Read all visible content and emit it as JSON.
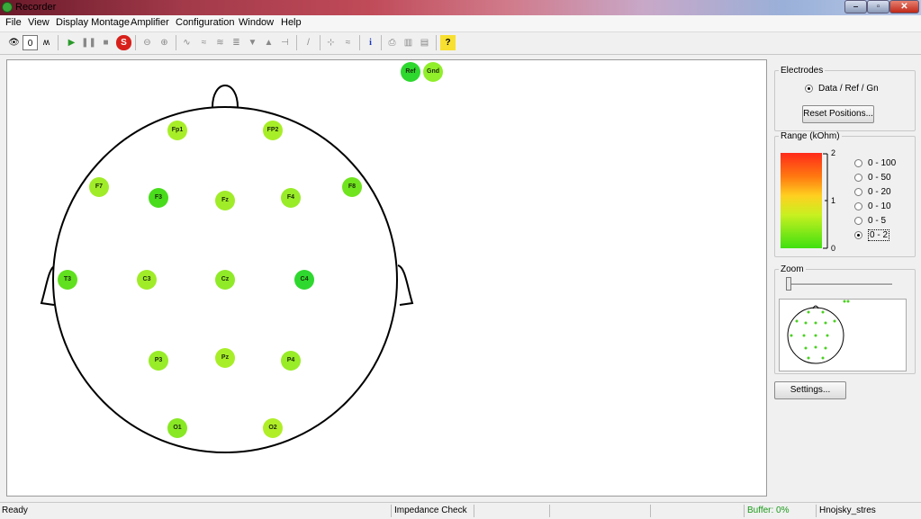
{
  "window": {
    "title": "Recorder",
    "controls": {
      "minimize": "–",
      "maximize": "▫",
      "close": "✕"
    }
  },
  "menu": [
    "File",
    "View",
    "Display Montage",
    "Amplifier",
    "Configuration",
    "Window",
    "Help"
  ],
  "toolbar": {
    "buttons": [
      {
        "name": "monitor-eye-icon",
        "glyph": "👁"
      },
      {
        "name": "impedance-zero-icon",
        "glyph": "0"
      },
      {
        "name": "wave-icon",
        "glyph": "ʍ"
      },
      {
        "name": "play-icon",
        "glyph": "▶"
      },
      {
        "name": "pause-icon",
        "glyph": "❚❚"
      },
      {
        "name": "stop-icon",
        "glyph": "■"
      },
      {
        "name": "record-icon",
        "glyph": "S"
      },
      {
        "name": "zoom-out-icon",
        "glyph": "⊖"
      },
      {
        "name": "zoom-in-icon",
        "glyph": "⊕"
      },
      {
        "name": "signal-icon",
        "glyph": "∿"
      },
      {
        "name": "signal-icon-2",
        "glyph": "≈"
      },
      {
        "name": "filter-icon",
        "glyph": "≋"
      },
      {
        "name": "overlay-icon",
        "glyph": "≣"
      },
      {
        "name": "overlay-icon-2",
        "glyph": "≋"
      },
      {
        "name": "triangle-down-icon",
        "glyph": "▼"
      },
      {
        "name": "triangle-up-icon",
        "glyph": "▲"
      },
      {
        "name": "marker-icon",
        "glyph": "⊣"
      },
      {
        "name": "pen-icon",
        "glyph": "/"
      },
      {
        "name": "segment-icon",
        "glyph": "⊹"
      },
      {
        "name": "segment-icon-2",
        "glyph": "≈"
      },
      {
        "name": "info-icon",
        "glyph": "i"
      },
      {
        "name": "print-icon",
        "glyph": "⎙"
      },
      {
        "name": "window-icon",
        "glyph": "▥"
      },
      {
        "name": "window-icon-2",
        "glyph": "▤"
      },
      {
        "name": "help-icon",
        "glyph": "?"
      }
    ]
  },
  "electrodes": [
    {
      "label": "Ref",
      "color": "#2ed82e"
    },
    {
      "label": "Gnd",
      "color": "#90ee2a"
    },
    {
      "label": "Fp1",
      "color": "#a8ee28"
    },
    {
      "label": "FP2",
      "color": "#a8ee28"
    },
    {
      "label": "F7",
      "color": "#a0ec28"
    },
    {
      "label": "F3",
      "color": "#48dc1c"
    },
    {
      "label": "Fz",
      "color": "#a0ec28"
    },
    {
      "label": "F4",
      "color": "#98ec28"
    },
    {
      "label": "F8",
      "color": "#70e41e"
    },
    {
      "label": "T3",
      "color": "#60e01e"
    },
    {
      "label": "C3",
      "color": "#a0ec28"
    },
    {
      "label": "Cz",
      "color": "#90ea28"
    },
    {
      "label": "C4",
      "color": "#2ed82e"
    },
    {
      "label": "P3",
      "color": "#98ec28"
    },
    {
      "label": "Pz",
      "color": "#a8ee28"
    },
    {
      "label": "P4",
      "color": "#98ec28"
    },
    {
      "label": "O1",
      "color": "#88e824"
    },
    {
      "label": "O2",
      "color": "#b0ee28"
    }
  ],
  "electrodes_group": {
    "title": "Electrodes",
    "radio_label": "Data / Ref / Gn",
    "reset_button": "Reset Positions..."
  },
  "range_group": {
    "title": "Range (kOhm)",
    "tick_top": "2",
    "tick_mid": "1",
    "tick_bottom": "0",
    "options": [
      "0 - 100",
      "0 - 50",
      "0 - 20",
      "0 - 10",
      "0 - 5",
      "0 - 2"
    ],
    "selected": "0 - 2"
  },
  "zoom_group": {
    "title": "Zoom",
    "level": 0
  },
  "settings_button": "Settings...",
  "status": {
    "left": "Ready",
    "mode": "Impedance Check",
    "buffer": "Buffer: 0%",
    "user": "Hnojsky_stres"
  }
}
